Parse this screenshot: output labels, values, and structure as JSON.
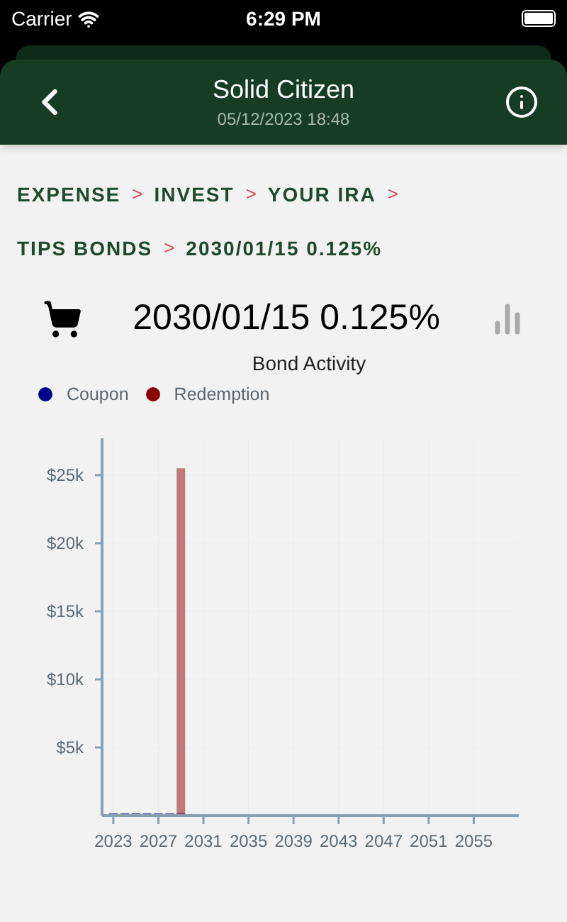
{
  "status_bar": {
    "carrier": "Carrier",
    "time": "6:29 PM"
  },
  "header": {
    "title": "Solid Citizen",
    "subtitle": "05/12/2023 18:48"
  },
  "breadcrumb_rows": [
    [
      {
        "label": "EXPENSE",
        "separator": ">"
      },
      {
        "label": "INVEST",
        "separator": ">"
      },
      {
        "label": "YOUR IRA",
        "separator": ">"
      }
    ],
    [
      {
        "label": "TIPS BONDS",
        "separator": ">"
      },
      {
        "label": "2030/01/15 0.125%"
      }
    ]
  ],
  "bond": {
    "title": "2030/01/15 0.125%",
    "chart": {
      "chart_data": {
        "type": "bar",
        "title": "Bond Activity",
        "x": [
          2023,
          2024,
          2025,
          2026,
          2027,
          2028,
          2029
        ],
        "series": [
          {
            "name": "Coupon",
            "color": "#00008b",
            "values": [
              0,
              0,
              0,
              0,
              0,
              0,
              0
            ]
          },
          {
            "name": "Redemption",
            "color": "#8b0000",
            "values": [
              null,
              null,
              null,
              null,
              null,
              null,
              25500
            ]
          }
        ],
        "xlim": [
          2022,
          2059
        ],
        "grid": true,
        "ylim": [
          0,
          27700
        ],
        "xticks": [
          2023,
          2027,
          2031,
          2035,
          2039,
          2043,
          2047,
          2051,
          2055
        ],
        "yticks": [
          {
            "value": 5000,
            "label": "$5k"
          },
          {
            "value": 10000,
            "label": "$10k"
          },
          {
            "value": 15000,
            "label": "$15k"
          },
          {
            "value": 20000,
            "label": "$20k"
          },
          {
            "value": 25000,
            "label": "$25k"
          }
        ]
      }
    }
  }
}
